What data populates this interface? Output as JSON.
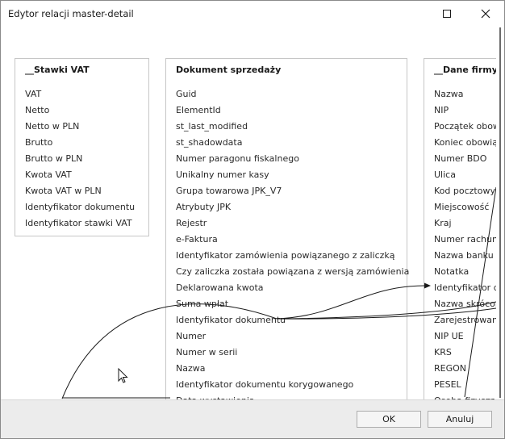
{
  "window": {
    "title": "Edytor relacji master-detail"
  },
  "tables": {
    "stawki": {
      "title": "__Stawki VAT",
      "fields": [
        "VAT",
        "Netto",
        "Netto w PLN",
        "Brutto",
        "Brutto w PLN",
        "Kwota VAT",
        "Kwota VAT w PLN",
        "Identyfikator dokumentu",
        "Identyfikator stawki VAT"
      ]
    },
    "dokument": {
      "title": "Dokument sprzedaży",
      "fields": [
        "Guid",
        "ElementId",
        "st_last_modified",
        "st_shadowdata",
        "Numer paragonu fiskalnego",
        "Unikalny numer kasy",
        "Grupa towarowa JPK_V7",
        "Atrybuty JPK",
        "Rejestr",
        "e-Faktura",
        "Identyfikator zamówienia powiązanego z zaliczką",
        "Czy zaliczka została powiązana z wersją zamówienia",
        "Deklarowana kwota",
        "Suma wpłat",
        "Identyfikator dokumentu",
        "Numer",
        "Numer w serii",
        "Nazwa",
        "Identyfikator dokumentu korygowanego",
        "Data wystawienia"
      ]
    },
    "firmy": {
      "title": "__Dane firmy",
      "fields": [
        "Nazwa",
        "NIP",
        "Początek obowiązywania",
        "Koniec obowiązywania",
        "Numer BDO",
        "Ulica",
        "Kod pocztowy",
        "Miejscowość",
        "Kraj",
        "Numer rachunku",
        "Nazwa banku",
        "Notatka",
        "Identyfikator dokumentu",
        "Nazwa skrócona",
        "Zarejestrowany w",
        "NIP UE",
        "KRS",
        "REGON",
        "PESEL",
        "Osoba fizyczna"
      ]
    }
  },
  "buttons": {
    "ok": "OK",
    "cancel": "Anuluj"
  },
  "icons": {
    "maximize": "maximize-icon",
    "close": "close-icon",
    "cursor": "mouse-pointer-icon"
  },
  "colors": {
    "link_line": "#1a1a1a",
    "box_border": "#c6c6c6",
    "footer_bg": "#ececec"
  }
}
